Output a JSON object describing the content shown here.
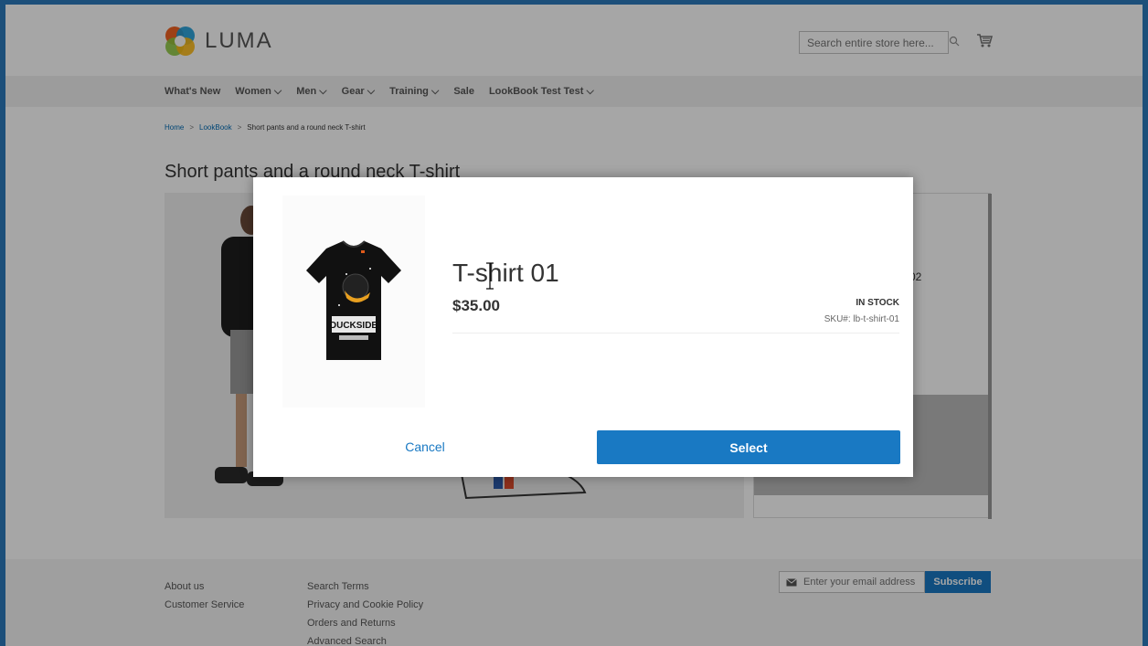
{
  "header": {
    "logo_text": "LUMA",
    "search_placeholder": "Search entire store here...",
    "cart_icon": "cart-icon",
    "search_icon": "search-icon"
  },
  "nav": {
    "items": [
      {
        "label": "What's New",
        "has_dropdown": false
      },
      {
        "label": "Women",
        "has_dropdown": true
      },
      {
        "label": "Men",
        "has_dropdown": true
      },
      {
        "label": "Gear",
        "has_dropdown": true
      },
      {
        "label": "Training",
        "has_dropdown": true
      },
      {
        "label": "Sale",
        "has_dropdown": false
      },
      {
        "label": "LookBook Test Test",
        "has_dropdown": true
      }
    ]
  },
  "breadcrumb": {
    "home": "Home",
    "lookbook": "LookBook",
    "current": "Short pants and a round neck T-shirt",
    "separator": ">"
  },
  "page": {
    "title": "Short pants and a round neck T-shirt",
    "sidebar_sku_fragment": "02"
  },
  "modal": {
    "product_name": "T-shirt 01",
    "price": "$35.00",
    "stock_status": "IN STOCK",
    "sku_label": "SKU#:",
    "sku_value": "lb-t-shirt-01",
    "cancel_label": "Cancel",
    "select_label": "Select",
    "tshirt_print_text": "DUCKSIDE"
  },
  "footer": {
    "col1": [
      "About us",
      "Customer Service"
    ],
    "col2": [
      "Search Terms",
      "Privacy and Cookie Policy",
      "Orders and Returns",
      "Advanced Search"
    ],
    "newsletter_placeholder": "Enter your email address",
    "subscribe_label": "Subscribe"
  },
  "colors": {
    "accent": "#1979c3",
    "link": "#006bb4",
    "frame_border": "#1c4f7a"
  }
}
